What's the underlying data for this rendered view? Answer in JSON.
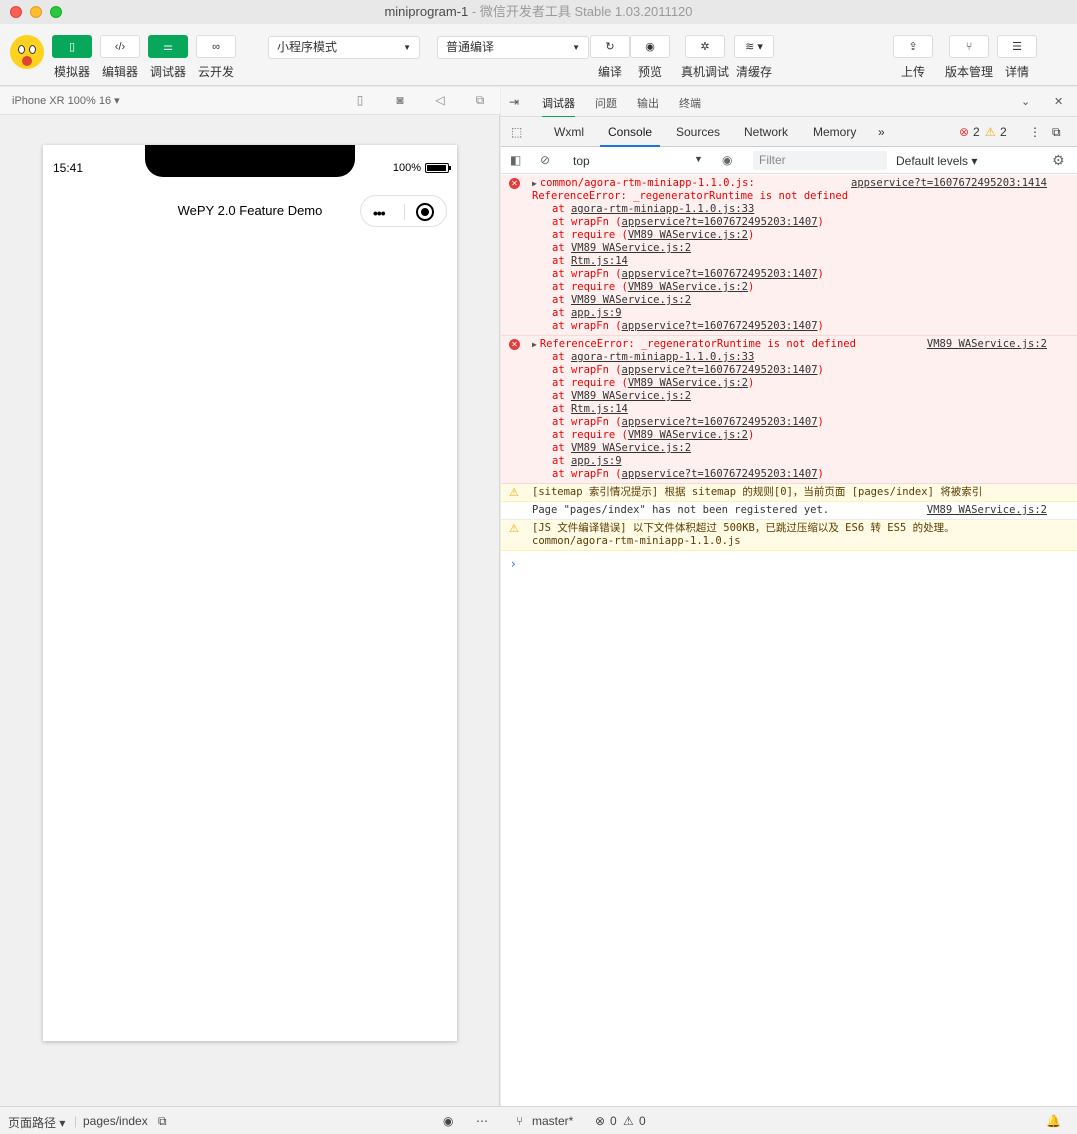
{
  "window": {
    "title": "miniprogram-1",
    "subtitle": " - 微信开发者工具 Stable 1.03.2011120"
  },
  "toolbar": {
    "simulator_label": "模拟器",
    "editor_label": "编辑器",
    "debugger_label": "调试器",
    "cloud_label": "云开发",
    "mode_select": "小程序模式",
    "compile_select": "普通编译",
    "compile_label": "编译",
    "preview_label": "预览",
    "remote_debug_label": "真机调试",
    "clear_cache_label": "清缓存",
    "upload_label": "上传",
    "version_label": "版本管理",
    "details_label": "详情"
  },
  "simulator": {
    "device": "iPhone XR 100% 16 ▾",
    "time": "15:41",
    "battery": "100%",
    "page_title": "WePY 2.0 Feature Demo",
    "capsule_dots": "•••"
  },
  "devtools": {
    "top_tabs": [
      "调试器",
      "问题",
      "输出",
      "终端"
    ],
    "tabs": [
      "Wxml",
      "Console",
      "Sources",
      "Network",
      "Memory"
    ],
    "more": "»",
    "error_count": "2",
    "warn_count": "2",
    "context": "top",
    "filter_placeholder": "Filter",
    "levels": "Default levels ▾"
  },
  "console": {
    "m1": {
      "head": "common/agora-rtm-miniapp-1.1.0.js:",
      "src": "appservice?t=1607672495203:1414",
      "line2": "ReferenceError: _regeneratorRuntime is not defined",
      "frames": [
        {
          "pre": "at ",
          "link": "agora-rtm-miniapp-1.1.0.js:33",
          "post": ""
        },
        {
          "pre": "at wrapFn (",
          "link": "appservice?t=1607672495203:1407",
          "post": ")"
        },
        {
          "pre": "at require (",
          "link": "VM89 WAService.js:2",
          "post": ")"
        },
        {
          "pre": "at ",
          "link": "VM89 WAService.js:2",
          "post": ""
        },
        {
          "pre": "at ",
          "link": "Rtm.js:14",
          "post": ""
        },
        {
          "pre": "at wrapFn (",
          "link": "appservice?t=1607672495203:1407",
          "post": ")"
        },
        {
          "pre": "at require (",
          "link": "VM89 WAService.js:2",
          "post": ")"
        },
        {
          "pre": "at ",
          "link": "VM89 WAService.js:2",
          "post": ""
        },
        {
          "pre": "at ",
          "link": "app.js:9",
          "post": ""
        },
        {
          "pre": "at wrapFn (",
          "link": "appservice?t=1607672495203:1407",
          "post": ")"
        }
      ]
    },
    "m2": {
      "head": "ReferenceError: _regeneratorRuntime is not defined",
      "src": "VM89 WAService.js:2",
      "frames": [
        {
          "pre": "at ",
          "link": "agora-rtm-miniapp-1.1.0.js:33",
          "post": ""
        },
        {
          "pre": "at wrapFn (",
          "link": "appservice?t=1607672495203:1407",
          "post": ")"
        },
        {
          "pre": "at require (",
          "link": "VM89 WAService.js:2",
          "post": ")"
        },
        {
          "pre": "at ",
          "link": "VM89 WAService.js:2",
          "post": ""
        },
        {
          "pre": "at ",
          "link": "Rtm.js:14",
          "post": ""
        },
        {
          "pre": "at wrapFn (",
          "link": "appservice?t=1607672495203:1407",
          "post": ")"
        },
        {
          "pre": "at require (",
          "link": "VM89 WAService.js:2",
          "post": ")"
        },
        {
          "pre": "at ",
          "link": "VM89 WAService.js:2",
          "post": ""
        },
        {
          "pre": "at ",
          "link": "app.js:9",
          "post": ""
        },
        {
          "pre": "at wrapFn (",
          "link": "appservice?t=1607672495203:1407",
          "post": ")"
        }
      ]
    },
    "m3": "[sitemap 索引情况提示] 根据 sitemap 的规则[0]，当前页面 [pages/index] 将被索引",
    "m4": {
      "text": "Page \"pages/index\" has not been registered yet.",
      "src": "VM89 WAService.js:2"
    },
    "m5": {
      "line1": "[JS 文件编译错误] 以下文件体积超过 500KB，已跳过压缩以及 ES6 转 ES5 的处理。",
      "line2": "common/agora-rtm-miniapp-1.1.0.js"
    },
    "prompt": "›"
  },
  "statusbar": {
    "path_label": "页面路径 ▾",
    "path": "pages/index",
    "branch": "master*",
    "errors": "0",
    "warnings": "0"
  }
}
